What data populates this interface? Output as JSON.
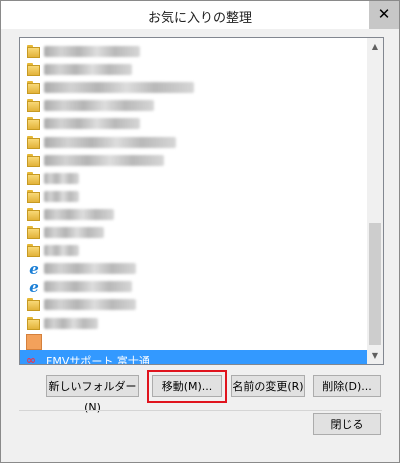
{
  "window": {
    "title": "お気に入りの整理",
    "close_glyph": "✕"
  },
  "list": {
    "items": [
      {
        "icon": "folder-icon",
        "text": ""
      },
      {
        "icon": "folder-icon",
        "text": ""
      },
      {
        "icon": "folder-icon",
        "text": ""
      },
      {
        "icon": "folder-icon",
        "text": ""
      },
      {
        "icon": "folder-icon",
        "text": ""
      },
      {
        "icon": "folder-icon",
        "text": ""
      },
      {
        "icon": "folder-icon",
        "text": ""
      },
      {
        "icon": "folder-icon",
        "text": ""
      },
      {
        "icon": "folder-icon",
        "text": ""
      },
      {
        "icon": "folder-icon",
        "text": ""
      },
      {
        "icon": "folder-icon",
        "text": ""
      },
      {
        "icon": "folder-icon",
        "text": ""
      },
      {
        "icon": "ie-icon",
        "text": ""
      },
      {
        "icon": "ie-icon",
        "text": ""
      },
      {
        "icon": "folder-icon",
        "text": ""
      },
      {
        "icon": "folder-icon",
        "text": ""
      },
      {
        "icon": "tile-icon",
        "text": ""
      },
      {
        "icon": "fmv-icon",
        "text": "FMVサポート  富士通",
        "selected": true
      }
    ],
    "selected_label": "FMVサポート  富士通",
    "ie_glyph": "e",
    "fmv_glyph": "∞",
    "scroll_up": "▲",
    "scroll_down": "▼"
  },
  "buttons": {
    "new_folder": "新しいフォルダー(N)",
    "move": "移動(M)...",
    "rename": "名前の変更(R)",
    "delete": "削除(D)...",
    "close": "閉じる"
  },
  "colors": {
    "selection": "#3399ff",
    "highlight_box": "#e0141e"
  }
}
